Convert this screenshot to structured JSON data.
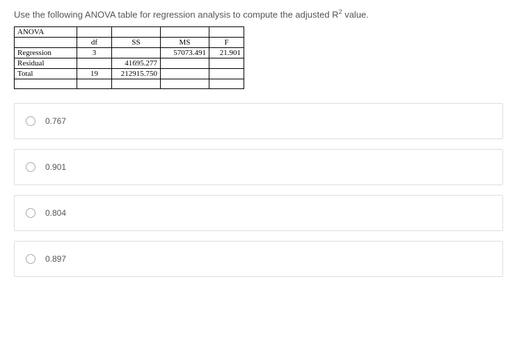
{
  "question": {
    "prefix": "Use the following ANOVA table for regression analysis to compute the adjusted R",
    "sup": "2",
    "suffix": "  value."
  },
  "table": {
    "title": "ANOVA",
    "headers": {
      "df": "df",
      "ss": "SS",
      "ms": "MS",
      "f": "F"
    },
    "rows": [
      {
        "label": "Regression",
        "df": "3",
        "ss": "",
        "ms": "57073.491",
        "f": "21.901"
      },
      {
        "label": "Residual",
        "df": "",
        "ss": "41695.277",
        "ms": "",
        "f": ""
      },
      {
        "label": "Total",
        "df": "19",
        "ss": "212915.750",
        "ms": "",
        "f": ""
      }
    ]
  },
  "options": [
    {
      "label": "0.767"
    },
    {
      "label": "0.901"
    },
    {
      "label": "0.804"
    },
    {
      "label": "0.897"
    }
  ]
}
